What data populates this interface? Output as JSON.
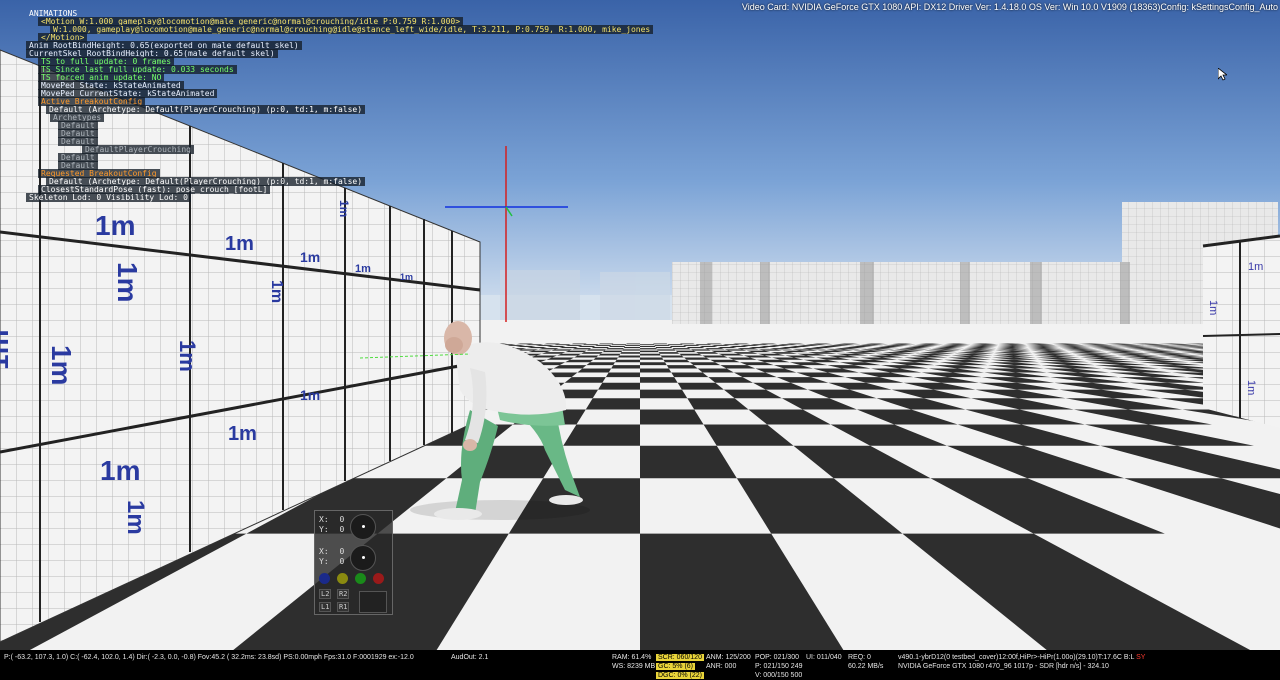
{
  "video_card": "Video Card: NVIDIA GeForce GTX 1080 API: DX12 Driver Ver: 1.4.18.0 OS Ver: Win 10.0 V1909 (18363)Config: kSettingsConfig_Auto",
  "debug": {
    "title": "ANIMATIONS",
    "lines": [
      "<Motion W:1.000 gameplay@locomotion@male_generic@normal@crouching/idle P:0.759 R:1.000>",
      "W:1.000, gameplay@locomotion@male_generic@normal@crouching@idle@stance_left_wide/idle, T:3.211, P:0.759, R:1.000, mike_jones",
      "</Motion>",
      "Anim RootBindHeight: 0.65(exported on male default skel)",
      "CurrentSkel RootBindHeight: 0.65(male default skel)",
      "TS to full update: 0 frames",
      "TS Since last full update: 0.033 seconds",
      "TS forced anim update: NO",
      "MovePed State: kStateAnimated",
      "MovePed CurrentState: kStateAnimated",
      "Active BreakoutConfig",
      "Default (Archetype: Default(PlayerCrouching) (p:0, td:1, m:false)",
      "Archetypes",
      "Default",
      "Default",
      "Default",
      "DefaultPlayerCrouching",
      "Default",
      "Default",
      "Requested BreakoutConfig",
      "Default (Archetype: Default(PlayerCrouching) (p:0, td:1, m:false)",
      "ClosestStandardPose (fast): pose_crouch_[footL]",
      "Skeleton Lod: 0   Visibility Lod: 0"
    ]
  },
  "gizmo": {
    "axis_colors": [
      "#d42020",
      "#1030e0",
      "#20c040"
    ]
  },
  "wall_label": "1m",
  "controller": {
    "x_label": "X:",
    "y_label": "Y:",
    "zero": "0",
    "face_buttons": [
      "#1a2a8a",
      "#8a8a10",
      "#1a8a1a",
      "#9a1a1a"
    ],
    "l2": "L2",
    "r2": "R2",
    "l1": "L1",
    "r1": "R1"
  },
  "status": {
    "pos": "P:( -63.2, 107.3,   1.0) C:( -62.4, 102.0,   1.4) Dir:( -2.3,  0.0,  -0.8) Fov:45.2 ( 32.2ms: 23.8sd)  PS:0.00mph  Fps:31.0  F:0001929  ex:-12.0",
    "audout": "AudOut: 2.1",
    "ram": "RAM:    61.4%",
    "ws": "WS: 8239 MB",
    "scr": "SCR: 060/120",
    "gc": "GC: 5% (6)",
    "dgc": "DGC: 0% (22)",
    "anm": "ANM: 125/200",
    "anr": "ANR: 000",
    "pop": "POP: 021/300",
    "p": "P: 021/150 249",
    "v": "V: 000/150 500",
    "ui": "UI: 011/040",
    "req": "REQ: 0",
    "mbs": "60.22 MB/s",
    "build1": "v490.1-ybrD12(0 testbed_cover)12:00f,HiPr>-HiPr(1.00o)(29.10)T:17.6C B:L",
    "build1_flag": "SY",
    "build2": "NVIDIA GeForce GTX 1080 r470_96 1017p - SDR [hdr n/s] - 324.10"
  }
}
